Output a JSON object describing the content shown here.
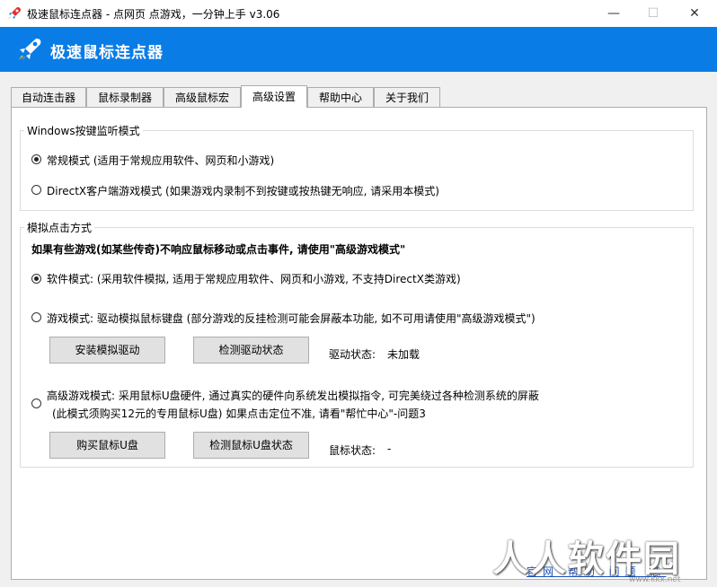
{
  "window": {
    "title": "极速鼠标连点器 - 点网页 点游戏，一分钟上手 v3.06",
    "minimize_glyph": "—",
    "maximize_glyph": "☐",
    "close_glyph": "✕"
  },
  "header": {
    "app_name": "极速鼠标连点器",
    "logo_icon": "rocket-icon",
    "bg_color": "#0a7ce6"
  },
  "tabs": [
    {
      "label": "自动连击器"
    },
    {
      "label": "鼠标录制器"
    },
    {
      "label": "高级鼠标宏"
    },
    {
      "label": "高级设置",
      "active": true
    },
    {
      "label": "帮助中心"
    },
    {
      "label": "关于我们"
    }
  ],
  "windows_group": {
    "title": "Windows按键监听模式",
    "options": [
      {
        "label": "常规模式 (适用于常规应用软件、网页和小游戏)",
        "checked": true
      },
      {
        "label": "DirectX客户端游戏模式 (如果游戏内录制不到按键或按热键无响应, 请采用本模式)",
        "checked": false
      }
    ]
  },
  "click_group": {
    "title": "模拟点击方式",
    "warning": "如果有些游戏(如某些传奇)不响应鼠标移动或点击事件, 请使用\"高级游戏模式\"",
    "software_mode": {
      "label": "软件模式:   (采用软件模拟, 适用于常规应用软件、网页和小游戏, 不支持DirectX类游戏)",
      "checked": true
    },
    "game_mode": {
      "label": "游戏模式:  驱动模拟鼠标键盘  (部分游戏的反挂检测可能会屏蔽本功能, 如不可用请使用\"高级游戏模式\")",
      "checked": false
    },
    "install_driver_button": "安装模拟驱动",
    "check_driver_button": "检测驱动状态",
    "driver_status_label": "驱动状态:",
    "driver_status_value": "未加载",
    "advanced_mode": {
      "line1": "高级游戏模式:  采用鼠标U盘硬件, 通过真实的硬件向系统发出模拟指令, 可完美绕过各种检测系统的屏蔽",
      "line2": "(此模式须购买12元的专用鼠标U盘)    如果点击定位不准, 请看\"帮忙中心\"-问题3",
      "checked": false
    },
    "buy_usb_button": "购买鼠标U盘",
    "check_usb_button": "检测鼠标U盘状态",
    "usb_status_label": "鼠标状态:",
    "usb_status_value": "-"
  },
  "watermark": {
    "text": "人人软件园",
    "url": "www.kkx.net"
  },
  "footer_links": "官网 帮助 问题 意"
}
